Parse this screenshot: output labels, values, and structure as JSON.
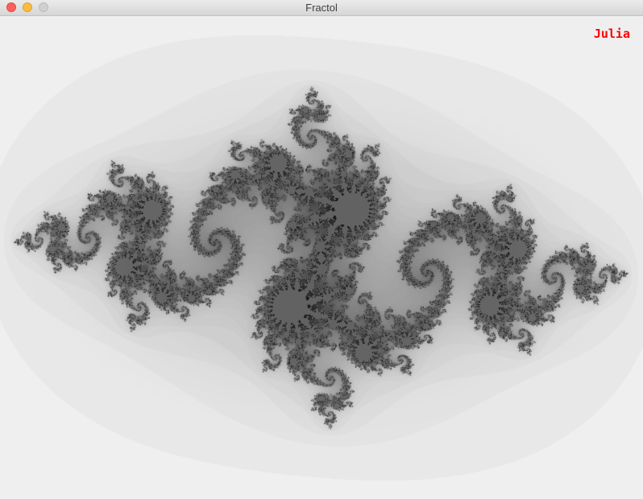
{
  "window": {
    "title": "Fractol",
    "controls": {
      "close": "close-icon",
      "minimize": "minimize-icon",
      "zoom": "zoom-icon"
    }
  },
  "fractal": {
    "type_label": "Julia",
    "label_color": "#ff0000",
    "background": "#ffffff",
    "ink": "#000000"
  }
}
